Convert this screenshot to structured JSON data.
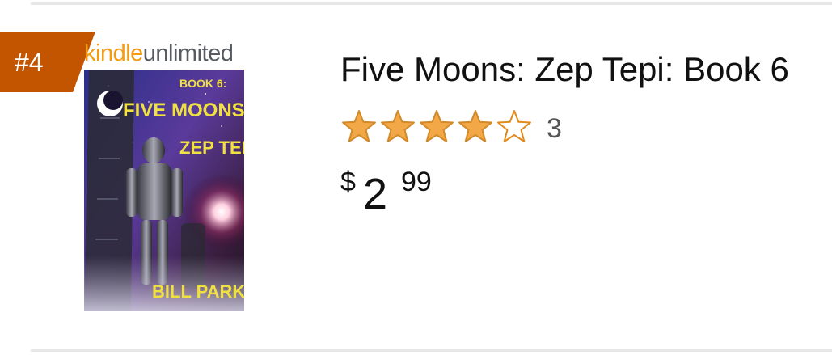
{
  "rank": {
    "label": "#4",
    "color": "#c45500"
  },
  "program_logo": {
    "part1": "kindle",
    "part2": "unlimited",
    "part1_color": "#f39c12",
    "part2_color": "#555b60"
  },
  "book": {
    "title": "Five Moons: Zep Tepi: Book 6",
    "rating": 4,
    "rating_max": 5,
    "rating_count": "3",
    "star_color": "#f3a847",
    "price": {
      "currency": "$",
      "whole": "2",
      "fraction": "99"
    },
    "cover": {
      "series_line": "BOOK 6:",
      "title_line1": "FIVE MOONS",
      "title_line2": "ZEP TEPI",
      "author": "BILL PARKER"
    }
  }
}
